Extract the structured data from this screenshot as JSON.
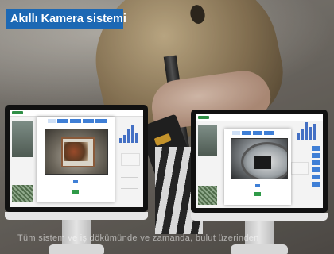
{
  "header": {
    "title": "Akıllı Kamera sistemi"
  },
  "caption": {
    "text": "Tüm sistem ve iş dökümünde ve zamanda, bulut üzerinden"
  },
  "colors": {
    "title_bg": "#1c68b4",
    "accent": "#3f7fd6",
    "ok": "#2f9a48"
  },
  "monitors": [
    {
      "label": "left-monitor",
      "camera": "camera-feed-1"
    },
    {
      "label": "right-monitor",
      "camera": "camera-feed-2"
    }
  ]
}
